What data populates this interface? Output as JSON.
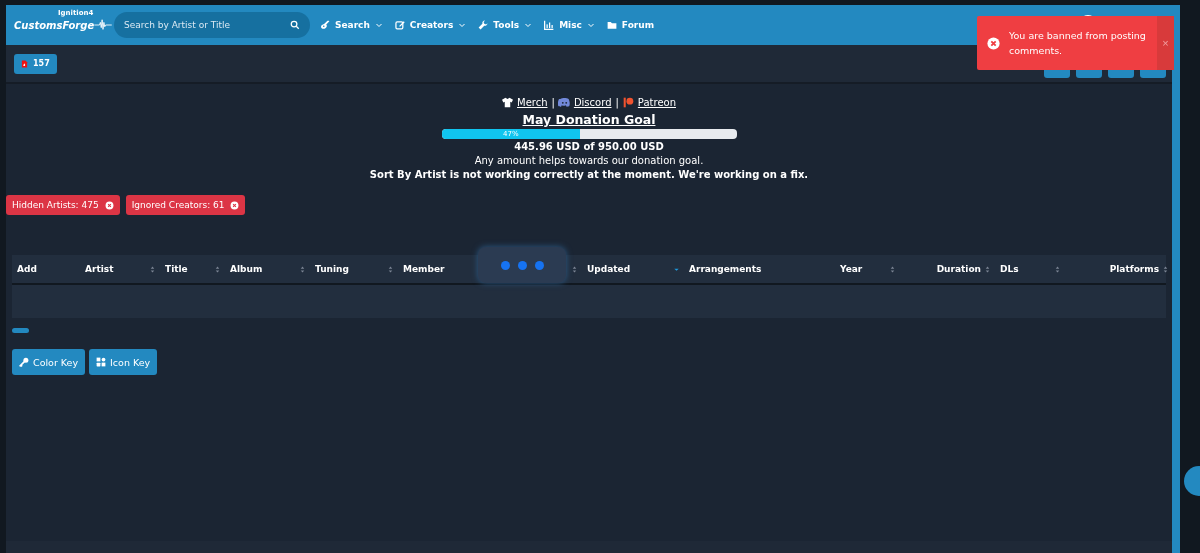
{
  "nav": {
    "logo": "CustomsForge",
    "logo_tag": "Ignition4",
    "search": {
      "placeholder": "Search by Artist or Title"
    },
    "menu": [
      {
        "label": "Search",
        "dropdown": true
      },
      {
        "label": "Creators",
        "dropdown": true
      },
      {
        "label": "Tools",
        "dropdown": true
      },
      {
        "label": "Misc",
        "dropdown": true
      },
      {
        "label": "Forum",
        "dropdown": false
      }
    ]
  },
  "toolbar": {
    "count": "157"
  },
  "links": [
    {
      "kind": "link",
      "text": "Merch"
    },
    {
      "kind": "sep",
      "text": "|"
    },
    {
      "kind": "link",
      "text": "Discord"
    },
    {
      "kind": "sep",
      "text": "|"
    },
    {
      "kind": "link",
      "text": "Patreon"
    }
  ],
  "donation": {
    "title": "May Donation Goal",
    "level": 0.47,
    "label": "47%",
    "amount": "445.96 USD of 950.00 USD",
    "note": "Any amount helps towards our donation goal.",
    "notice": "Sort By Artist is not working correctly at the moment. We're working on a fix."
  },
  "filters": [
    {
      "label": "Hidden Artists: 475"
    },
    {
      "label": "Ignored Creators: 61"
    }
  ],
  "table": {
    "columns": [
      {
        "label": "Add",
        "sortable": false
      },
      {
        "label": "Artist",
        "sortable": true,
        "sorted_descending": false
      },
      {
        "label": "Title",
        "sortable": true,
        "sorted_descending": false
      },
      {
        "label": "Album",
        "sortable": true,
        "sorted_descending": false
      },
      {
        "label": "Tuning",
        "sortable": true,
        "sorted_descending": false
      },
      {
        "label": "Member",
        "sortable": true,
        "sorted_descending": false
      },
      {
        "label": "Updated",
        "sortable": true,
        "sorted_descending": true
      },
      {
        "label": "Arrangements",
        "sortable": false
      },
      {
        "label": "Year",
        "sortable": true,
        "sorted_descending": false
      },
      {
        "label": "Duration",
        "sortable": true,
        "sorted_descending": false
      },
      {
        "label": "DLs",
        "sortable": true,
        "sorted_descending": false
      },
      {
        "label": "Platforms",
        "sortable": true,
        "sorted_descending": false
      }
    ]
  },
  "key_buttons": [
    {
      "label": "Color Key"
    },
    {
      "label": "Icon Key"
    }
  ],
  "toast": {
    "message": "You are banned from posting comments.",
    "close": "×"
  }
}
